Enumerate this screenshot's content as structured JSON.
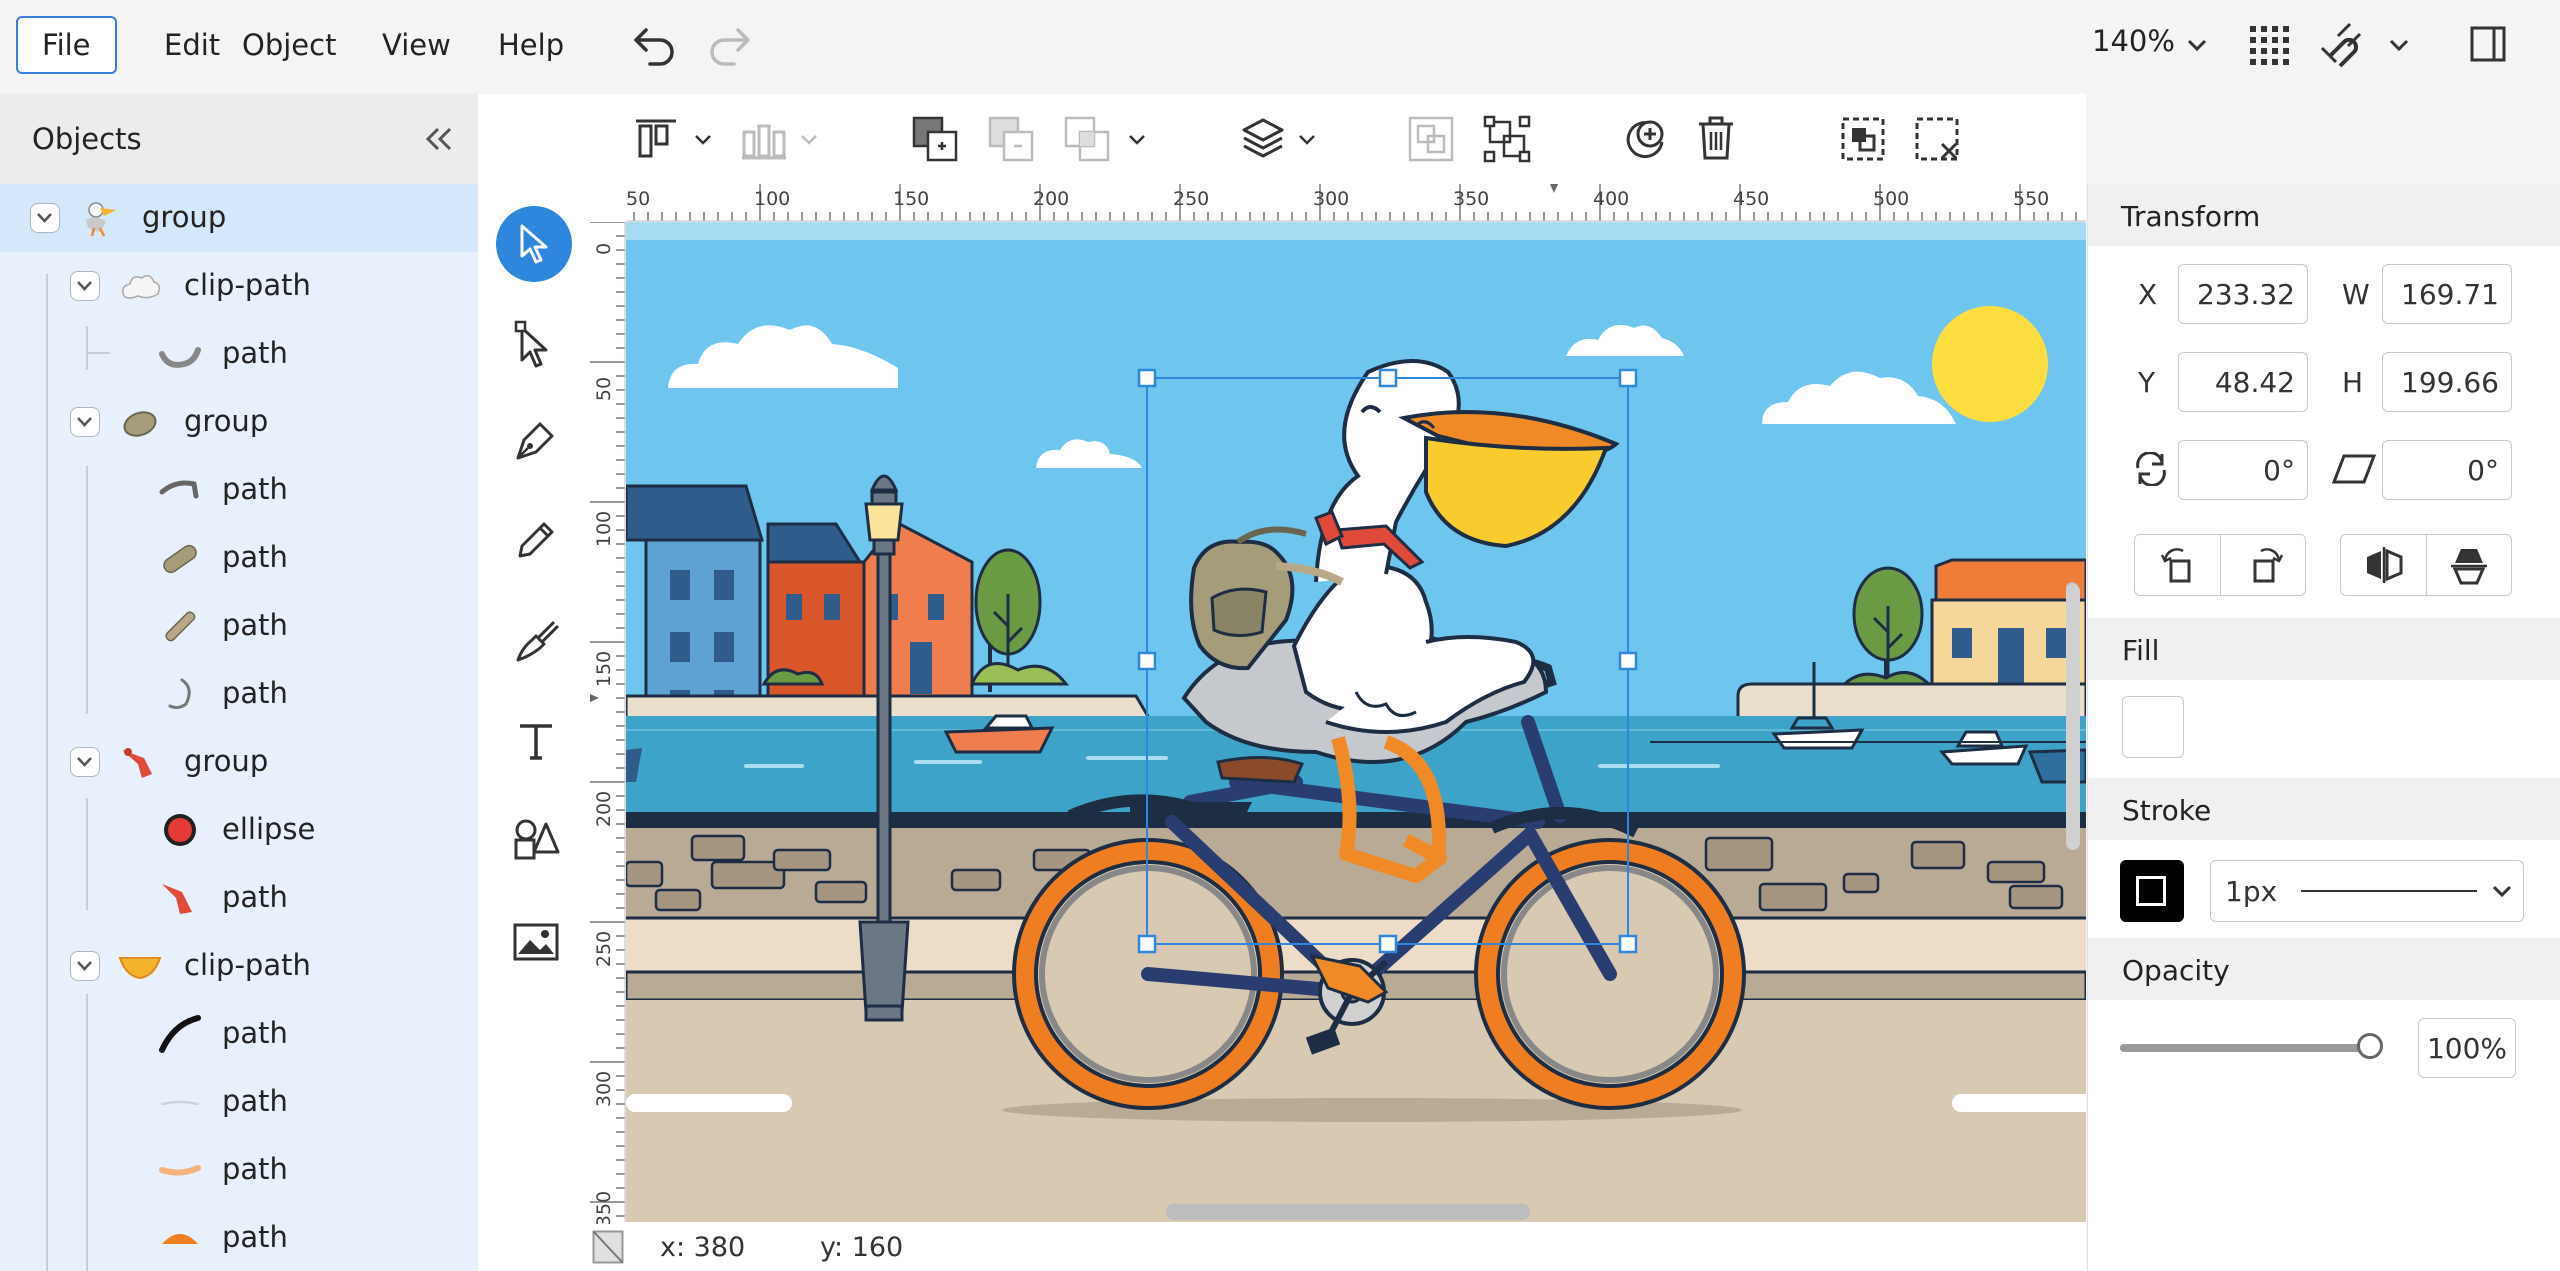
{
  "menu": {
    "items": [
      "File",
      "Edit",
      "Object",
      "View",
      "Help"
    ],
    "active": "File",
    "zoom": "140%"
  },
  "objects_panel": {
    "title": "Objects",
    "tree": [
      {
        "label": "group",
        "depth": 0,
        "expandable": true,
        "selected": true,
        "thumb": "pelican-icon"
      },
      {
        "label": "clip-path",
        "depth": 1,
        "expandable": true,
        "thumb": "cloud-shape-icon"
      },
      {
        "label": "path",
        "depth": 2,
        "thumb": "gray-curve-icon"
      },
      {
        "label": "group",
        "depth": 1,
        "expandable": true,
        "thumb": "bag-shape-icon"
      },
      {
        "label": "path",
        "depth": 2,
        "thumb": "strap-path-icon"
      },
      {
        "label": "path",
        "depth": 2,
        "thumb": "tan-bar-icon"
      },
      {
        "label": "path",
        "depth": 2,
        "thumb": "tan-stick-icon"
      },
      {
        "label": "path",
        "depth": 2,
        "thumb": "hook-path-icon"
      },
      {
        "label": "group",
        "depth": 1,
        "expandable": true,
        "thumb": "scarf-shape-icon"
      },
      {
        "label": "ellipse",
        "depth": 2,
        "thumb": "red-ellipse-icon"
      },
      {
        "label": "path",
        "depth": 2,
        "thumb": "scarf-path-icon"
      },
      {
        "label": "clip-path",
        "depth": 1,
        "expandable": true,
        "thumb": "beak-shape-icon"
      },
      {
        "label": "path",
        "depth": 2,
        "thumb": "black-stroke-icon"
      },
      {
        "label": "path",
        "depth": 2,
        "thumb": "light-line-icon"
      },
      {
        "label": "path",
        "depth": 2,
        "thumb": "peach-stroke-icon"
      },
      {
        "label": "path",
        "depth": 2,
        "thumb": "orange-arc-icon"
      }
    ]
  },
  "toolbar": {
    "icons": [
      "align-top-icon",
      "distribute-icon",
      "boolean-union-icon",
      "boolean-subtract-icon",
      "boolean-intersect-icon",
      "layers-icon",
      "group-icon",
      "ungroup-icon",
      "add-symbol-icon",
      "delete-icon",
      "select-all-icon",
      "deselect-icon"
    ]
  },
  "tools": [
    "select-tool",
    "node-tool",
    "pen-tool",
    "pencil-tool",
    "brush-tool",
    "text-tool",
    "shapes-tool",
    "image-tool"
  ],
  "rulers": {
    "top": [
      "50",
      "100",
      "150",
      "200",
      "250",
      "300",
      "350",
      "400",
      "450",
      "500",
      "550"
    ],
    "left": [
      "0",
      "50",
      "100",
      "150",
      "200",
      "250",
      "300",
      "350"
    ]
  },
  "status": {
    "x": "x: 380",
    "y": "y: 160"
  },
  "properties": {
    "transform": {
      "title": "Transform",
      "x_label": "X",
      "x": "233.32",
      "w_label": "W",
      "w": "169.71",
      "y_label": "Y",
      "y": "48.42",
      "h_label": "H",
      "h": "199.66",
      "rotation": "0°",
      "skew": "0°"
    },
    "fill": {
      "title": "Fill"
    },
    "stroke": {
      "title": "Stroke",
      "width": "1px"
    },
    "opacity": {
      "title": "Opacity",
      "value": "100%",
      "level": 1.0
    }
  },
  "colors": {
    "accent": "#3b7ddd",
    "tool_active": "#2f86dd",
    "selection": "#2f86dd",
    "sky": "#6ec6ee",
    "water": "#3da3c8"
  }
}
